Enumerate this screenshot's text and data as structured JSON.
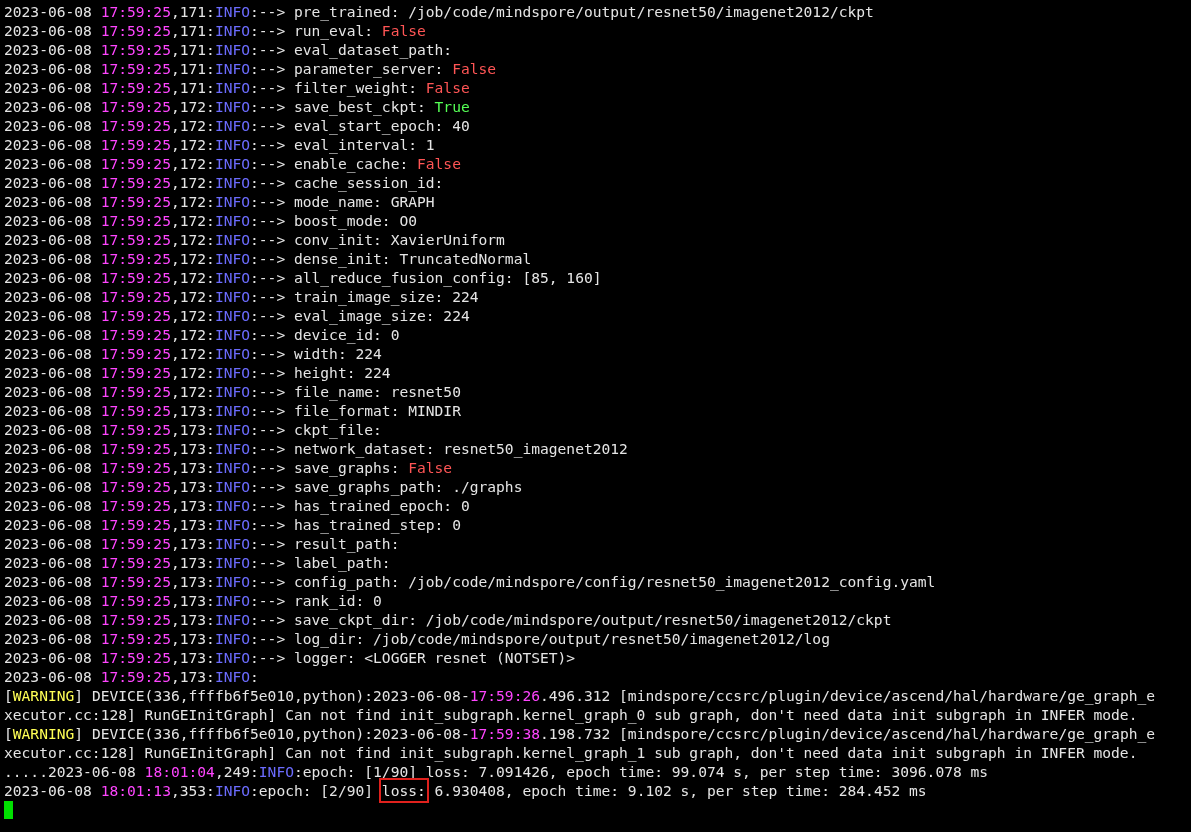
{
  "lines": [
    {
      "segments": [
        {
          "kind": "plain",
          "text": "2023-06-08 "
        },
        {
          "kind": "time",
          "text": "17:59:25"
        },
        {
          "kind": "plain",
          "text": ",171:"
        },
        {
          "kind": "level",
          "text": "INFO"
        },
        {
          "kind": "plain",
          "text": ":--> pre_trained: /job/code/mindspore/output/resnet50/imagenet2012/ckpt"
        }
      ]
    },
    {
      "segments": [
        {
          "kind": "plain",
          "text": "2023-06-08 "
        },
        {
          "kind": "time",
          "text": "17:59:25"
        },
        {
          "kind": "plain",
          "text": ",171:"
        },
        {
          "kind": "level",
          "text": "INFO"
        },
        {
          "kind": "plain",
          "text": ":--> run_eval: "
        },
        {
          "kind": "false",
          "text": "False"
        }
      ]
    },
    {
      "segments": [
        {
          "kind": "plain",
          "text": "2023-06-08 "
        },
        {
          "kind": "time",
          "text": "17:59:25"
        },
        {
          "kind": "plain",
          "text": ",171:"
        },
        {
          "kind": "level",
          "text": "INFO"
        },
        {
          "kind": "plain",
          "text": ":--> eval_dataset_path:"
        }
      ]
    },
    {
      "segments": [
        {
          "kind": "plain",
          "text": "2023-06-08 "
        },
        {
          "kind": "time",
          "text": "17:59:25"
        },
        {
          "kind": "plain",
          "text": ",171:"
        },
        {
          "kind": "level",
          "text": "INFO"
        },
        {
          "kind": "plain",
          "text": ":--> parameter_server: "
        },
        {
          "kind": "false",
          "text": "False"
        }
      ]
    },
    {
      "segments": [
        {
          "kind": "plain",
          "text": "2023-06-08 "
        },
        {
          "kind": "time",
          "text": "17:59:25"
        },
        {
          "kind": "plain",
          "text": ",171:"
        },
        {
          "kind": "level",
          "text": "INFO"
        },
        {
          "kind": "plain",
          "text": ":--> filter_weight: "
        },
        {
          "kind": "false",
          "text": "False"
        }
      ]
    },
    {
      "segments": [
        {
          "kind": "plain",
          "text": "2023-06-08 "
        },
        {
          "kind": "time",
          "text": "17:59:25"
        },
        {
          "kind": "plain",
          "text": ",172:"
        },
        {
          "kind": "level",
          "text": "INFO"
        },
        {
          "kind": "plain",
          "text": ":--> save_best_ckpt: "
        },
        {
          "kind": "true",
          "text": "True"
        }
      ]
    },
    {
      "segments": [
        {
          "kind": "plain",
          "text": "2023-06-08 "
        },
        {
          "kind": "time",
          "text": "17:59:25"
        },
        {
          "kind": "plain",
          "text": ",172:"
        },
        {
          "kind": "level",
          "text": "INFO"
        },
        {
          "kind": "plain",
          "text": ":--> eval_start_epoch: 40"
        }
      ]
    },
    {
      "segments": [
        {
          "kind": "plain",
          "text": "2023-06-08 "
        },
        {
          "kind": "time",
          "text": "17:59:25"
        },
        {
          "kind": "plain",
          "text": ",172:"
        },
        {
          "kind": "level",
          "text": "INFO"
        },
        {
          "kind": "plain",
          "text": ":--> eval_interval: 1"
        }
      ]
    },
    {
      "segments": [
        {
          "kind": "plain",
          "text": "2023-06-08 "
        },
        {
          "kind": "time",
          "text": "17:59:25"
        },
        {
          "kind": "plain",
          "text": ",172:"
        },
        {
          "kind": "level",
          "text": "INFO"
        },
        {
          "kind": "plain",
          "text": ":--> enable_cache: "
        },
        {
          "kind": "false",
          "text": "False"
        }
      ]
    },
    {
      "segments": [
        {
          "kind": "plain",
          "text": "2023-06-08 "
        },
        {
          "kind": "time",
          "text": "17:59:25"
        },
        {
          "kind": "plain",
          "text": ",172:"
        },
        {
          "kind": "level",
          "text": "INFO"
        },
        {
          "kind": "plain",
          "text": ":--> cache_session_id:"
        }
      ]
    },
    {
      "segments": [
        {
          "kind": "plain",
          "text": "2023-06-08 "
        },
        {
          "kind": "time",
          "text": "17:59:25"
        },
        {
          "kind": "plain",
          "text": ",172:"
        },
        {
          "kind": "level",
          "text": "INFO"
        },
        {
          "kind": "plain",
          "text": ":--> mode_name: GRAPH"
        }
      ]
    },
    {
      "segments": [
        {
          "kind": "plain",
          "text": "2023-06-08 "
        },
        {
          "kind": "time",
          "text": "17:59:25"
        },
        {
          "kind": "plain",
          "text": ",172:"
        },
        {
          "kind": "level",
          "text": "INFO"
        },
        {
          "kind": "plain",
          "text": ":--> boost_mode: O0"
        }
      ]
    },
    {
      "segments": [
        {
          "kind": "plain",
          "text": "2023-06-08 "
        },
        {
          "kind": "time",
          "text": "17:59:25"
        },
        {
          "kind": "plain",
          "text": ",172:"
        },
        {
          "kind": "level",
          "text": "INFO"
        },
        {
          "kind": "plain",
          "text": ":--> conv_init: XavierUniform"
        }
      ]
    },
    {
      "segments": [
        {
          "kind": "plain",
          "text": "2023-06-08 "
        },
        {
          "kind": "time",
          "text": "17:59:25"
        },
        {
          "kind": "plain",
          "text": ",172:"
        },
        {
          "kind": "level",
          "text": "INFO"
        },
        {
          "kind": "plain",
          "text": ":--> dense_init: TruncatedNormal"
        }
      ]
    },
    {
      "segments": [
        {
          "kind": "plain",
          "text": "2023-06-08 "
        },
        {
          "kind": "time",
          "text": "17:59:25"
        },
        {
          "kind": "plain",
          "text": ",172:"
        },
        {
          "kind": "level",
          "text": "INFO"
        },
        {
          "kind": "plain",
          "text": ":--> all_reduce_fusion_config: [85, 160]"
        }
      ]
    },
    {
      "segments": [
        {
          "kind": "plain",
          "text": "2023-06-08 "
        },
        {
          "kind": "time",
          "text": "17:59:25"
        },
        {
          "kind": "plain",
          "text": ",172:"
        },
        {
          "kind": "level",
          "text": "INFO"
        },
        {
          "kind": "plain",
          "text": ":--> train_image_size: 224"
        }
      ]
    },
    {
      "segments": [
        {
          "kind": "plain",
          "text": "2023-06-08 "
        },
        {
          "kind": "time",
          "text": "17:59:25"
        },
        {
          "kind": "plain",
          "text": ",172:"
        },
        {
          "kind": "level",
          "text": "INFO"
        },
        {
          "kind": "plain",
          "text": ":--> eval_image_size: 224"
        }
      ]
    },
    {
      "segments": [
        {
          "kind": "plain",
          "text": "2023-06-08 "
        },
        {
          "kind": "time",
          "text": "17:59:25"
        },
        {
          "kind": "plain",
          "text": ",172:"
        },
        {
          "kind": "level",
          "text": "INFO"
        },
        {
          "kind": "plain",
          "text": ":--> device_id: 0"
        }
      ]
    },
    {
      "segments": [
        {
          "kind": "plain",
          "text": "2023-06-08 "
        },
        {
          "kind": "time",
          "text": "17:59:25"
        },
        {
          "kind": "plain",
          "text": ",172:"
        },
        {
          "kind": "level",
          "text": "INFO"
        },
        {
          "kind": "plain",
          "text": ":--> width: 224"
        }
      ]
    },
    {
      "segments": [
        {
          "kind": "plain",
          "text": "2023-06-08 "
        },
        {
          "kind": "time",
          "text": "17:59:25"
        },
        {
          "kind": "plain",
          "text": ",172:"
        },
        {
          "kind": "level",
          "text": "INFO"
        },
        {
          "kind": "plain",
          "text": ":--> height: 224"
        }
      ]
    },
    {
      "segments": [
        {
          "kind": "plain",
          "text": "2023-06-08 "
        },
        {
          "kind": "time",
          "text": "17:59:25"
        },
        {
          "kind": "plain",
          "text": ",172:"
        },
        {
          "kind": "level",
          "text": "INFO"
        },
        {
          "kind": "plain",
          "text": ":--> file_name: resnet50"
        }
      ]
    },
    {
      "segments": [
        {
          "kind": "plain",
          "text": "2023-06-08 "
        },
        {
          "kind": "time",
          "text": "17:59:25"
        },
        {
          "kind": "plain",
          "text": ",173:"
        },
        {
          "kind": "level",
          "text": "INFO"
        },
        {
          "kind": "plain",
          "text": ":--> file_format: MINDIR"
        }
      ]
    },
    {
      "segments": [
        {
          "kind": "plain",
          "text": "2023-06-08 "
        },
        {
          "kind": "time",
          "text": "17:59:25"
        },
        {
          "kind": "plain",
          "text": ",173:"
        },
        {
          "kind": "level",
          "text": "INFO"
        },
        {
          "kind": "plain",
          "text": ":--> ckpt_file:"
        }
      ]
    },
    {
      "segments": [
        {
          "kind": "plain",
          "text": "2023-06-08 "
        },
        {
          "kind": "time",
          "text": "17:59:25"
        },
        {
          "kind": "plain",
          "text": ",173:"
        },
        {
          "kind": "level",
          "text": "INFO"
        },
        {
          "kind": "plain",
          "text": ":--> network_dataset: resnet50_imagenet2012"
        }
      ]
    },
    {
      "segments": [
        {
          "kind": "plain",
          "text": "2023-06-08 "
        },
        {
          "kind": "time",
          "text": "17:59:25"
        },
        {
          "kind": "plain",
          "text": ",173:"
        },
        {
          "kind": "level",
          "text": "INFO"
        },
        {
          "kind": "plain",
          "text": ":--> save_graphs: "
        },
        {
          "kind": "false",
          "text": "False"
        }
      ]
    },
    {
      "segments": [
        {
          "kind": "plain",
          "text": "2023-06-08 "
        },
        {
          "kind": "time",
          "text": "17:59:25"
        },
        {
          "kind": "plain",
          "text": ",173:"
        },
        {
          "kind": "level",
          "text": "INFO"
        },
        {
          "kind": "plain",
          "text": ":--> save_graphs_path: ./graphs"
        }
      ]
    },
    {
      "segments": [
        {
          "kind": "plain",
          "text": "2023-06-08 "
        },
        {
          "kind": "time",
          "text": "17:59:25"
        },
        {
          "kind": "plain",
          "text": ",173:"
        },
        {
          "kind": "level",
          "text": "INFO"
        },
        {
          "kind": "plain",
          "text": ":--> has_trained_epoch: 0"
        }
      ]
    },
    {
      "segments": [
        {
          "kind": "plain",
          "text": "2023-06-08 "
        },
        {
          "kind": "time",
          "text": "17:59:25"
        },
        {
          "kind": "plain",
          "text": ",173:"
        },
        {
          "kind": "level",
          "text": "INFO"
        },
        {
          "kind": "plain",
          "text": ":--> has_trained_step: 0"
        }
      ]
    },
    {
      "segments": [
        {
          "kind": "plain",
          "text": "2023-06-08 "
        },
        {
          "kind": "time",
          "text": "17:59:25"
        },
        {
          "kind": "plain",
          "text": ",173:"
        },
        {
          "kind": "level",
          "text": "INFO"
        },
        {
          "kind": "plain",
          "text": ":--> result_path:"
        }
      ]
    },
    {
      "segments": [
        {
          "kind": "plain",
          "text": "2023-06-08 "
        },
        {
          "kind": "time",
          "text": "17:59:25"
        },
        {
          "kind": "plain",
          "text": ",173:"
        },
        {
          "kind": "level",
          "text": "INFO"
        },
        {
          "kind": "plain",
          "text": ":--> label_path:"
        }
      ]
    },
    {
      "segments": [
        {
          "kind": "plain",
          "text": "2023-06-08 "
        },
        {
          "kind": "time",
          "text": "17:59:25"
        },
        {
          "kind": "plain",
          "text": ",173:"
        },
        {
          "kind": "level",
          "text": "INFO"
        },
        {
          "kind": "plain",
          "text": ":--> config_path: /job/code/mindspore/config/resnet50_imagenet2012_config.yaml"
        }
      ]
    },
    {
      "segments": [
        {
          "kind": "plain",
          "text": "2023-06-08 "
        },
        {
          "kind": "time",
          "text": "17:59:25"
        },
        {
          "kind": "plain",
          "text": ",173:"
        },
        {
          "kind": "level",
          "text": "INFO"
        },
        {
          "kind": "plain",
          "text": ":--> rank_id: 0"
        }
      ]
    },
    {
      "segments": [
        {
          "kind": "plain",
          "text": "2023-06-08 "
        },
        {
          "kind": "time",
          "text": "17:59:25"
        },
        {
          "kind": "plain",
          "text": ",173:"
        },
        {
          "kind": "level",
          "text": "INFO"
        },
        {
          "kind": "plain",
          "text": ":--> save_ckpt_dir: /job/code/mindspore/output/resnet50/imagenet2012/ckpt"
        }
      ]
    },
    {
      "segments": [
        {
          "kind": "plain",
          "text": "2023-06-08 "
        },
        {
          "kind": "time",
          "text": "17:59:25"
        },
        {
          "kind": "plain",
          "text": ",173:"
        },
        {
          "kind": "level",
          "text": "INFO"
        },
        {
          "kind": "plain",
          "text": ":--> log_dir: /job/code/mindspore/output/resnet50/imagenet2012/log"
        }
      ]
    },
    {
      "segments": [
        {
          "kind": "plain",
          "text": "2023-06-08 "
        },
        {
          "kind": "time",
          "text": "17:59:25"
        },
        {
          "kind": "plain",
          "text": ",173:"
        },
        {
          "kind": "level",
          "text": "INFO"
        },
        {
          "kind": "plain",
          "text": ":--> logger: <LOGGER resnet (NOTSET)>"
        }
      ]
    },
    {
      "segments": [
        {
          "kind": "plain",
          "text": "2023-06-08 "
        },
        {
          "kind": "time",
          "text": "17:59:25"
        },
        {
          "kind": "plain",
          "text": ",173:"
        },
        {
          "kind": "level",
          "text": "INFO"
        },
        {
          "kind": "plain",
          "text": ":"
        }
      ]
    },
    {
      "segments": [
        {
          "kind": "plain",
          "text": "["
        },
        {
          "kind": "warning",
          "text": "WARNING"
        },
        {
          "kind": "plain",
          "text": "] DEVICE(336,ffffb6f5e010,python):2023-06-08-"
        },
        {
          "kind": "time",
          "text": "17:59:26"
        },
        {
          "kind": "plain",
          "text": ".496.312 [mindspore/ccsrc/plugin/device/ascend/hal/hardware/ge_graph_e"
        }
      ]
    },
    {
      "segments": [
        {
          "kind": "plain",
          "text": "xecutor.cc:128] RunGEInitGraph] Can not find init_subgraph.kernel_graph_0 sub graph, don't need data init subgraph in INFER mode."
        }
      ]
    },
    {
      "segments": [
        {
          "kind": "plain",
          "text": "["
        },
        {
          "kind": "warning",
          "text": "WARNING"
        },
        {
          "kind": "plain",
          "text": "] DEVICE(336,ffffb6f5e010,python):2023-06-08-"
        },
        {
          "kind": "time",
          "text": "17:59:38"
        },
        {
          "kind": "plain",
          "text": ".198.732 [mindspore/ccsrc/plugin/device/ascend/hal/hardware/ge_graph_e"
        }
      ]
    },
    {
      "segments": [
        {
          "kind": "plain",
          "text": "xecutor.cc:128] RunGEInitGraph] Can not find init_subgraph.kernel_graph_1 sub graph, don't need data init subgraph in INFER mode."
        }
      ]
    },
    {
      "segments": [
        {
          "kind": "plain",
          "text": ".....2023-06-08 "
        },
        {
          "kind": "time",
          "text": "18:01:04"
        },
        {
          "kind": "plain",
          "text": ",249:"
        },
        {
          "kind": "level",
          "text": "INFO"
        },
        {
          "kind": "plain",
          "text": ":epoch: [1/90] loss: 7.091426, epoch time: 99.074 s, per step time: 3096.078 ms"
        }
      ]
    },
    {
      "segments": [
        {
          "kind": "plain",
          "text": "2023-06-08 "
        },
        {
          "kind": "time",
          "text": "18:01:13"
        },
        {
          "kind": "plain",
          "text": ",353:"
        },
        {
          "kind": "level",
          "text": "INFO"
        },
        {
          "kind": "plain",
          "text": ":epoch: [2/90] "
        },
        {
          "kind": "boxed",
          "text": "loss:"
        },
        {
          "kind": "plain",
          "text": " 6.930408, epoch time: 9.102 s, per step time: 284.452 ms"
        }
      ]
    }
  ]
}
